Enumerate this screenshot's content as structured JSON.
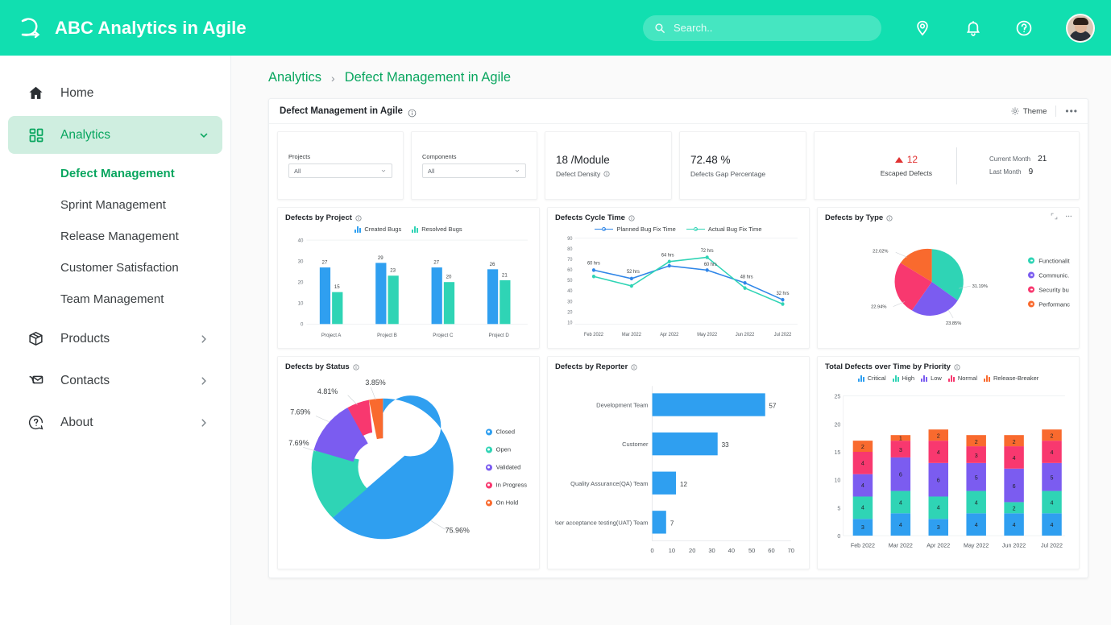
{
  "header": {
    "app_title": "ABC Analytics in Agile",
    "logo_icon": "refresh-arrow-icon",
    "search": {
      "placeholder": "Search..",
      "value": "",
      "icon": "search-icon"
    },
    "icons": [
      {
        "name": "location-pin-icon"
      },
      {
        "name": "notification-bell-icon"
      },
      {
        "name": "help-circle-icon"
      }
    ],
    "avatar": "user-avatar",
    "brand_color": "#11dfb0"
  },
  "sidebar": {
    "items": [
      {
        "label": "Home",
        "icon": "home-icon",
        "active": false,
        "chevron": ""
      },
      {
        "label": "Analytics",
        "icon": "grid-icon",
        "active": true,
        "chevron": "down"
      },
      {
        "label": "Products",
        "icon": "box-icon",
        "active": false,
        "chevron": "right"
      },
      {
        "label": "Contacts",
        "icon": "contact-mail-icon",
        "active": false,
        "chevron": "right"
      },
      {
        "label": "About",
        "icon": "question-circle-icon",
        "active": false,
        "chevron": "right"
      }
    ],
    "sub_items": [
      {
        "label": "Defect Management",
        "current": true
      },
      {
        "label": "Sprint Management",
        "current": false
      },
      {
        "label": "Release Management",
        "current": false
      },
      {
        "label": "Customer Satisfaction",
        "current": false
      },
      {
        "label": "Team Management",
        "current": false
      }
    ],
    "active_color": "#09a65f"
  },
  "breadcrumb": {
    "root": "Analytics",
    "separator": "›",
    "current": "Defect Management in Agile"
  },
  "panel": {
    "title": "Defect Management in Agile",
    "info_icon": "info-icon",
    "theme_label": "Theme",
    "theme_icon": "palette-icon",
    "more_label": "•••"
  },
  "kpis": {
    "projects": {
      "label": "Projects",
      "value": "All",
      "options": [
        "All"
      ]
    },
    "components": {
      "label": "Components",
      "value": "All",
      "options": [
        "All"
      ]
    },
    "defect_density": {
      "value": "18 /Module",
      "label": "Defect Density"
    },
    "defects_gap": {
      "value": "72.48 %",
      "label": "Defects Gap Percentage"
    },
    "escaped": {
      "value": "12",
      "label": "Escaped Defects",
      "trend": "up",
      "trend_color": "#e03131",
      "current_month_label": "Current Month",
      "current_month_value": "21",
      "last_month_label": "Last Month",
      "last_month_value": "9"
    }
  },
  "chart_data": [
    {
      "id": "defects-by-project",
      "type": "bar",
      "title": "Defects by Project",
      "categories": [
        "Project A",
        "Project B",
        "Project C",
        "Project D"
      ],
      "series": [
        {
          "name": "Created Bugs",
          "color": "#2f9ff0",
          "values": [
            27,
            29,
            27,
            26
          ]
        },
        {
          "name": "Resolved Bugs",
          "color": "#2fd4b5",
          "values": [
            15,
            23,
            20,
            21
          ]
        }
      ],
      "ylim": [
        0,
        40
      ],
      "yticks": [
        0,
        10,
        20,
        30,
        40
      ],
      "xlabel": "",
      "ylabel": "",
      "grid": false,
      "legend": "top"
    },
    {
      "id": "defects-cycle-time",
      "type": "line",
      "title": "Defects Cycle Time",
      "categories": [
        "Feb 2022",
        "Mar 2022",
        "Apr 2022",
        "May 2022",
        "Jun 2022",
        "Jul 2022"
      ],
      "series": [
        {
          "name": "Planned Bug Fix Time",
          "color": "#2f86e8",
          "values": [
            60,
            52,
            64,
            60,
            48,
            32
          ]
        },
        {
          "name": "Actual Bug Fix Time",
          "color": "#2fd4b5",
          "values": [
            54,
            45,
            68,
            72,
            43,
            28
          ]
        }
      ],
      "point_labels": [
        "60 hrs",
        "52 hrs",
        "64 hrs",
        "72 hrs",
        "60 hrs",
        "48 hrs",
        "32 hrs"
      ],
      "ylim": [
        10,
        90
      ],
      "yticks": [
        10,
        20,
        30,
        40,
        50,
        60,
        70,
        80,
        90
      ],
      "grid": false,
      "legend": "top"
    },
    {
      "id": "defects-by-type",
      "type": "pie",
      "title": "Defects by Type",
      "labels": [
        "Functionalit",
        "Communic.",
        "Security bu",
        "Performanc"
      ],
      "values": [
        31.19,
        23.85,
        22.94,
        22.02
      ],
      "value_labels": [
        "31.19%",
        "23.85%",
        "22.94%",
        "22.02%"
      ],
      "colors": [
        "#2fd4b5",
        "#7b5cf0",
        "#f8386f",
        "#f96a2e"
      ],
      "legend": "right"
    },
    {
      "id": "defects-by-status",
      "type": "pie",
      "title": "Defects by Status",
      "donut": true,
      "labels": [
        "Closed",
        "Open",
        "Validated",
        "In Progress",
        "On Hold"
      ],
      "values": [
        75.96,
        7.69,
        7.69,
        4.81,
        3.85
      ],
      "value_labels": [
        "75.96%",
        "7.69%",
        "7.69%",
        "4.81%",
        "3.85%"
      ],
      "colors": [
        "#2f9ff0",
        "#2fd4b5",
        "#7b5cf0",
        "#f8386f",
        "#f96a2e"
      ],
      "legend": "right"
    },
    {
      "id": "defects-by-reporter",
      "type": "bar",
      "orientation": "horizontal",
      "title": "Defects by Reporter",
      "categories": [
        "Development Team",
        "Customer",
        "Quality Assurance(QA) Team",
        "User acceptance testing(UAT) Team"
      ],
      "values": [
        57,
        33,
        12,
        7
      ],
      "color": "#2f9ff0",
      "xlim": [
        0,
        70
      ],
      "xticks": [
        0,
        10,
        20,
        30,
        40,
        50,
        60,
        70
      ],
      "grid": false,
      "legend": "none"
    },
    {
      "id": "total-defects-over-time-by-priority",
      "type": "bar",
      "stacked": true,
      "title": "Total Defects over Time by Priority",
      "categories": [
        "Feb 2022",
        "Mar 2022",
        "Apr 2022",
        "May 2022",
        "Jun 2022",
        "Jul 2022"
      ],
      "series": [
        {
          "name": "Critical",
          "color": "#2f9ff0",
          "values": [
            3,
            4,
            3,
            4,
            4,
            4
          ]
        },
        {
          "name": "High",
          "color": "#2fd4b5",
          "values": [
            4,
            4,
            4,
            4,
            2,
            4
          ]
        },
        {
          "name": "Low",
          "color": "#7b5cf0",
          "values": [
            4,
            6,
            6,
            5,
            6,
            5
          ]
        },
        {
          "name": "Normal",
          "color": "#f8386f",
          "values": [
            4,
            3,
            4,
            3,
            4,
            4
          ]
        },
        {
          "name": "Release-Breaker",
          "color": "#f96a2e",
          "values": [
            2,
            1,
            2,
            2,
            2,
            2
          ]
        }
      ],
      "ylim": [
        0,
        25
      ],
      "yticks": [
        0,
        5,
        10,
        15,
        20,
        25
      ],
      "grid": false,
      "legend": "top"
    }
  ]
}
